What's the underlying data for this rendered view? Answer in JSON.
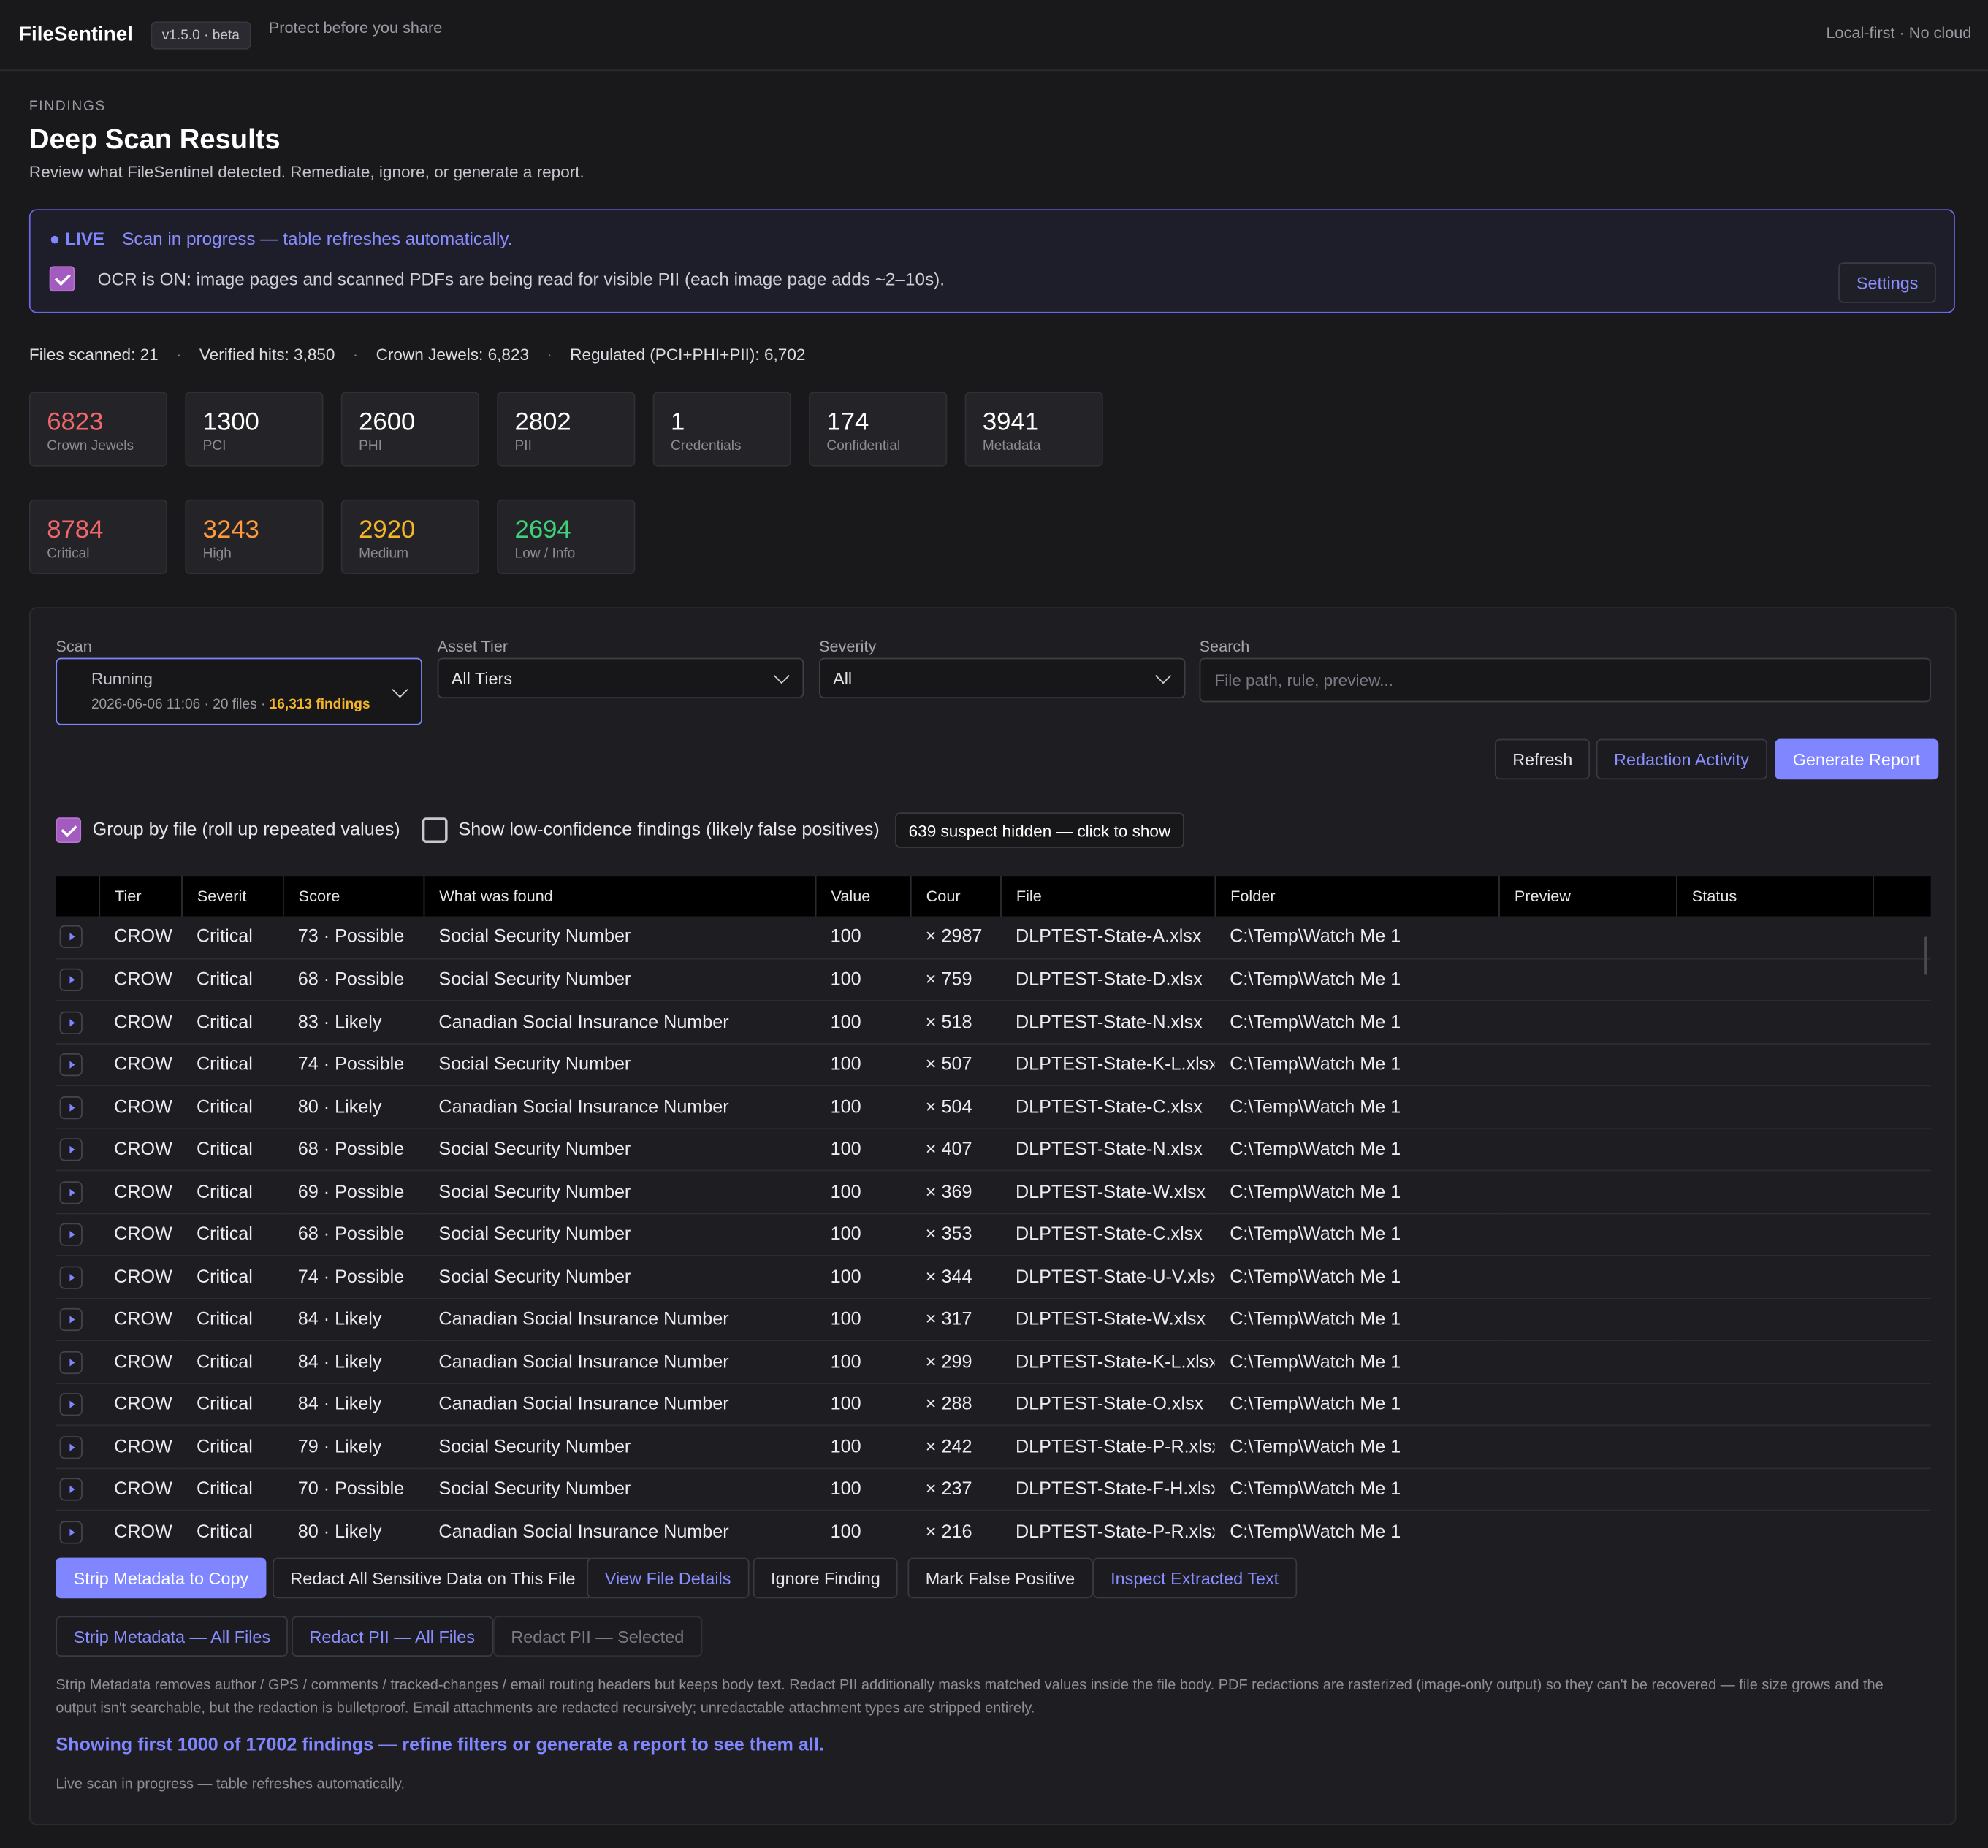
{
  "app": {
    "name": "FileSentinel",
    "version": "v1.5.0 · beta",
    "tagline": "Protect before you share",
    "top_right": "Local-first · No cloud"
  },
  "page": {
    "section": "FINDINGS",
    "title": "Deep Scan Results",
    "subtitle": "Review what FileSentinel detected. Remediate, ignore, or generate a report."
  },
  "live": {
    "tag": "● LIVE",
    "text": "Scan in progress — table refreshes automatically.",
    "ocr_checked": true,
    "ocr_text": "OCR is ON: image pages and scanned PDFs are being read for visible PII (each image page adds ~2–10s).",
    "settings_label": "Settings"
  },
  "stats": {
    "files_scanned": "Files scanned: 21",
    "verified_hits": "Verified hits: 3,850",
    "crown_jewels": "Crown Jewels: 6,823",
    "regulated": "Regulated (PCI+PHI+PII): 6,702",
    "separator": "·"
  },
  "category_cards": [
    {
      "value": "6823",
      "label": "Crown Jewels",
      "color": "#f0676b"
    },
    {
      "value": "1300",
      "label": "PCI",
      "color": "#ffffff"
    },
    {
      "value": "2600",
      "label": "PHI",
      "color": "#ffffff"
    },
    {
      "value": "2802",
      "label": "PII",
      "color": "#ffffff"
    },
    {
      "value": "1",
      "label": "Credentials",
      "color": "#ffffff"
    },
    {
      "value": "174",
      "label": "Confidential",
      "color": "#ffffff"
    },
    {
      "value": "3941",
      "label": "Metadata",
      "color": "#ffffff"
    }
  ],
  "severity_cards": [
    {
      "value": "8784",
      "label": "Critical",
      "color": "#f0676b"
    },
    {
      "value": "3243",
      "label": "High",
      "color": "#ff9a3c"
    },
    {
      "value": "2920",
      "label": "Medium",
      "color": "#f5b728"
    },
    {
      "value": "2694",
      "label": "Low / Info",
      "color": "#3fd07a"
    }
  ],
  "filters": {
    "scan_label": "Scan",
    "scan_status": "Running",
    "scan_meta": "2026-06-06 11:06 · 20 files · ",
    "scan_findings": "16,313 findings",
    "tier_label": "Asset Tier",
    "tier_value": "All Tiers",
    "severity_label": "Severity",
    "severity_value": "All",
    "search_label": "Search",
    "search_placeholder": "File path, rule, preview..."
  },
  "actions": {
    "refresh": "Refresh",
    "redaction_activity": "Redaction Activity",
    "generate_report": "Generate Report"
  },
  "options": {
    "group_by_file_checked": true,
    "group_by_file": "Group by file (roll up repeated values)",
    "show_low_conf_checked": false,
    "show_low_conf": "Show low-confidence findings (likely false positives)",
    "suspect_hidden": "639 suspect hidden — click to show"
  },
  "table": {
    "columns": [
      "",
      "Tier",
      "Severit",
      "Score",
      "What was found",
      "Value",
      "Cour",
      "File",
      "Folder",
      "Preview",
      "Status",
      ""
    ],
    "rows": [
      [
        "CROW",
        "Critical",
        "73 · Possible",
        "Social Security Number",
        "100",
        "× 2987",
        "DLPTEST-State-A.xlsx",
        "C:\\Temp\\Watch Me 1",
        "",
        ""
      ],
      [
        "CROW",
        "Critical",
        "68 · Possible",
        "Social Security Number",
        "100",
        "× 759",
        "DLPTEST-State-D.xlsx",
        "C:\\Temp\\Watch Me 1",
        "",
        ""
      ],
      [
        "CROW",
        "Critical",
        "83 · Likely",
        "Canadian Social Insurance Number",
        "100",
        "× 518",
        "DLPTEST-State-N.xlsx",
        "C:\\Temp\\Watch Me 1",
        "",
        ""
      ],
      [
        "CROW",
        "Critical",
        "74 · Possible",
        "Social Security Number",
        "100",
        "× 507",
        "DLPTEST-State-K-L.xlsx",
        "C:\\Temp\\Watch Me 1",
        "",
        ""
      ],
      [
        "CROW",
        "Critical",
        "80 · Likely",
        "Canadian Social Insurance Number",
        "100",
        "× 504",
        "DLPTEST-State-C.xlsx",
        "C:\\Temp\\Watch Me 1",
        "",
        ""
      ],
      [
        "CROW",
        "Critical",
        "68 · Possible",
        "Social Security Number",
        "100",
        "× 407",
        "DLPTEST-State-N.xlsx",
        "C:\\Temp\\Watch Me 1",
        "",
        ""
      ],
      [
        "CROW",
        "Critical",
        "69 · Possible",
        "Social Security Number",
        "100",
        "× 369",
        "DLPTEST-State-W.xlsx",
        "C:\\Temp\\Watch Me 1",
        "",
        ""
      ],
      [
        "CROW",
        "Critical",
        "68 · Possible",
        "Social Security Number",
        "100",
        "× 353",
        "DLPTEST-State-C.xlsx",
        "C:\\Temp\\Watch Me 1",
        "",
        ""
      ],
      [
        "CROW",
        "Critical",
        "74 · Possible",
        "Social Security Number",
        "100",
        "× 344",
        "DLPTEST-State-U-V.xlsx",
        "C:\\Temp\\Watch Me 1",
        "",
        ""
      ],
      [
        "CROW",
        "Critical",
        "84 · Likely",
        "Canadian Social Insurance Number",
        "100",
        "× 317",
        "DLPTEST-State-W.xlsx",
        "C:\\Temp\\Watch Me 1",
        "",
        ""
      ],
      [
        "CROW",
        "Critical",
        "84 · Likely",
        "Canadian Social Insurance Number",
        "100",
        "× 299",
        "DLPTEST-State-K-L.xlsx",
        "C:\\Temp\\Watch Me 1",
        "",
        ""
      ],
      [
        "CROW",
        "Critical",
        "84 · Likely",
        "Canadian Social Insurance Number",
        "100",
        "× 288",
        "DLPTEST-State-O.xlsx",
        "C:\\Temp\\Watch Me 1",
        "",
        ""
      ],
      [
        "CROW",
        "Critical",
        "79 · Likely",
        "Social Security Number",
        "100",
        "× 242",
        "DLPTEST-State-P-R.xlsx",
        "C:\\Temp\\Watch Me 1",
        "",
        ""
      ],
      [
        "CROW",
        "Critical",
        "70 · Possible",
        "Social Security Number",
        "100",
        "× 237",
        "DLPTEST-State-F-H.xlsx",
        "C:\\Temp\\Watch Me 1",
        "",
        ""
      ],
      [
        "CROW",
        "Critical",
        "80 · Likely",
        "Canadian Social Insurance Number",
        "100",
        "× 216",
        "DLPTEST-State-P-R.xlsx",
        "C:\\Temp\\Watch Me 1",
        "",
        ""
      ]
    ]
  },
  "row_actions": {
    "strip_metadata_copy": "Strip Metadata to Copy",
    "redact_all_file": "Redact All Sensitive Data on This File",
    "view_file_details": "View File Details",
    "ignore_finding": "Ignore Finding",
    "mark_false_positive": "Mark False Positive",
    "inspect_text": "Inspect Extracted Text",
    "strip_metadata_all": "Strip Metadata — All Files",
    "redact_pii_all": "Redact PII — All Files",
    "redact_pii_selected": "Redact PII — Selected"
  },
  "footer": {
    "note": "Strip Metadata removes author / GPS / comments / tracked-changes / email routing headers but keeps body text. Redact PII additionally masks matched values inside the file body. PDF redactions are rasterized (image-only output) so they can't be recovered — file size grows and the output isn't searchable, but the redaction is bulletproof. Email attachments are redacted recursively; unredactable attachment types are stripped entirely.",
    "showing": "Showing first 1000 of 17002 findings — refine filters or generate a report to see them all.",
    "live_note": "Live scan in progress — table refreshes automatically."
  }
}
